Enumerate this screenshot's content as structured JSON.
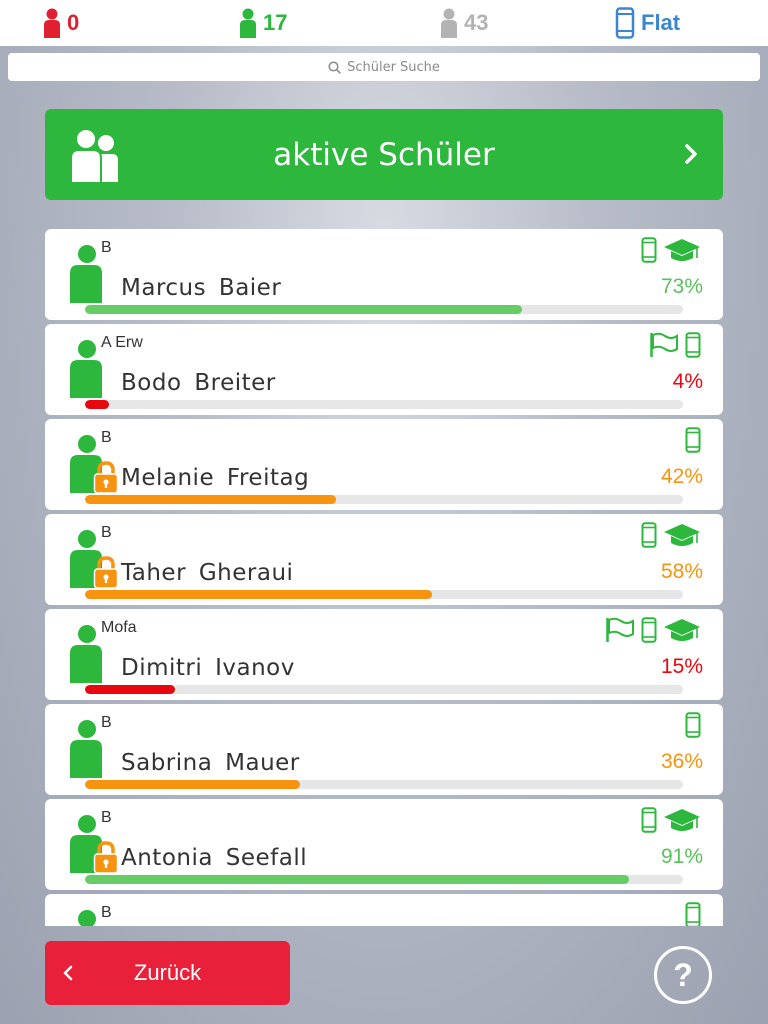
{
  "counters": [
    {
      "value": "0",
      "icon": "person-icon",
      "color": "#e0202f"
    },
    {
      "value": "17",
      "icon": "person-icon",
      "color": "#2db83d"
    },
    {
      "value": "43",
      "icon": "person-icon",
      "color": "#b3b3b3"
    },
    {
      "value": "Flat",
      "icon": "phone-icon",
      "color": "#3b86cf"
    }
  ],
  "search": {
    "placeholder": "Schüler Suche"
  },
  "group": {
    "title": "aktive Schüler"
  },
  "students": [
    {
      "class": "B",
      "first": "Marcus",
      "last": "Baier",
      "percent": "73%",
      "progress": 0.73,
      "status": "green",
      "locked": false,
      "icons": [
        "phone-icon",
        "graduation-cap-icon"
      ]
    },
    {
      "class": "A Erw",
      "first": "Bodo",
      "last": "Breiter",
      "percent": "4%",
      "progress": 0.04,
      "status": "red",
      "locked": false,
      "icons": [
        "flag-icon",
        "phone-icon"
      ]
    },
    {
      "class": "B",
      "first": "Melanie",
      "last": "Freitag",
      "percent": "42%",
      "progress": 0.42,
      "status": "orange",
      "locked": true,
      "icons": [
        "phone-icon"
      ]
    },
    {
      "class": "B",
      "first": "Taher",
      "last": "Gheraui",
      "percent": "58%",
      "progress": 0.58,
      "status": "orange",
      "locked": true,
      "icons": [
        "phone-icon",
        "graduation-cap-icon"
      ]
    },
    {
      "class": "Mofa",
      "first": "Dimitri",
      "last": "Ivanov",
      "percent": "15%",
      "progress": 0.15,
      "status": "red",
      "locked": false,
      "icons": [
        "flag-icon",
        "phone-icon",
        "graduation-cap-icon"
      ]
    },
    {
      "class": "B",
      "first": "Sabrina",
      "last": "Mauer",
      "percent": "36%",
      "progress": 0.36,
      "status": "orange",
      "locked": false,
      "icons": [
        "phone-icon"
      ]
    },
    {
      "class": "B",
      "first": "Antonia",
      "last": "Seefall",
      "percent": "91%",
      "progress": 0.91,
      "status": "green",
      "locked": true,
      "icons": [
        "phone-icon",
        "graduation-cap-icon"
      ]
    },
    {
      "class": "B",
      "first": "",
      "last": "",
      "percent": "",
      "progress": null,
      "status": "green",
      "locked": false,
      "icons": [
        "phone-icon"
      ]
    }
  ],
  "colors": {
    "green": "#2db83d",
    "progress_green": "#66cc66",
    "orange": "#f7930f",
    "red": "#e8060f",
    "text_green": "#5cc05c"
  },
  "footer": {
    "back_label": "Zurück",
    "help_label": "?"
  }
}
